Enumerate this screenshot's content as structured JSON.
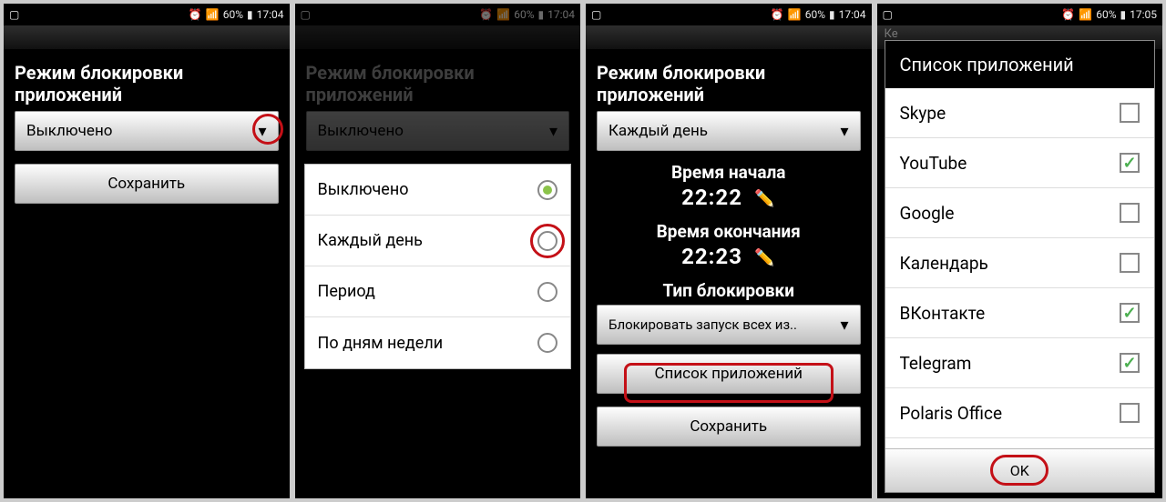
{
  "status": {
    "battery": "60%",
    "time_a": "17:04",
    "time_b": "17:05",
    "alarm_icon": "⏰",
    "wifi_icon": "📶",
    "signal_icon": "▮",
    "batt_icon": "▮",
    "cast_icon": "▢"
  },
  "p1": {
    "heading": "Режим блокировки приложений",
    "spinner": "Выключено",
    "save": "Сохранить"
  },
  "p2": {
    "heading": "Режим блокировки приложений",
    "spinner": "Выключено",
    "options": [
      {
        "label": "Выключено",
        "selected": true
      },
      {
        "label": "Каждый день",
        "selected": false
      },
      {
        "label": "Период",
        "selected": false
      },
      {
        "label": "По дням недели",
        "selected": false
      }
    ]
  },
  "p3": {
    "heading": "Режим блокировки приложений",
    "spinner": "Каждый день",
    "start_label": "Время начала",
    "start_time": "22:22",
    "end_label": "Время окончания",
    "end_time": "22:23",
    "type_label": "Тип блокировки",
    "type_spinner": "Блокировать запуск всех из..",
    "apps_btn": "Список приложений",
    "save": "Сохранить",
    "pencil": "✏️"
  },
  "p4": {
    "hint": "Ке",
    "dlg_title": "Список приложений",
    "apps": [
      {
        "name": "Skype",
        "checked": false
      },
      {
        "name": "YouTube",
        "checked": true
      },
      {
        "name": "Google",
        "checked": false
      },
      {
        "name": "Календарь",
        "checked": false
      },
      {
        "name": "ВКонтакте",
        "checked": true
      },
      {
        "name": "Telegram",
        "checked": true
      },
      {
        "name": "Polaris Office",
        "checked": false
      }
    ],
    "ok": "OK"
  }
}
